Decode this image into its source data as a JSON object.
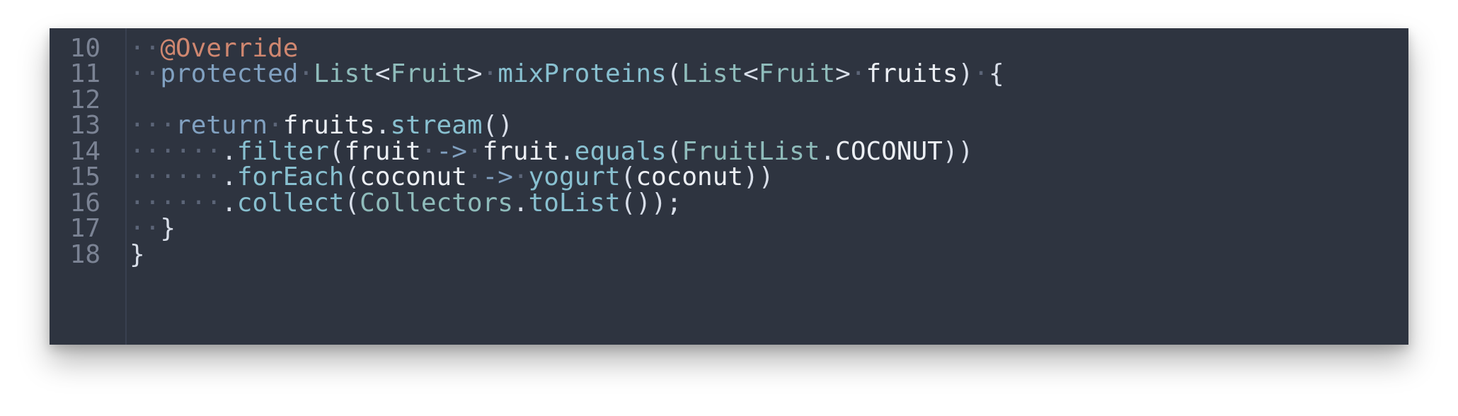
{
  "editor": {
    "lines": [
      {
        "number": "10",
        "tokens": [
          {
            "t": "··",
            "c": "ws"
          },
          {
            "t": "@Override",
            "c": "ann"
          }
        ]
      },
      {
        "number": "11",
        "tokens": [
          {
            "t": "··",
            "c": "ws"
          },
          {
            "t": "protected",
            "c": "kw"
          },
          {
            "t": "·",
            "c": "ws"
          },
          {
            "t": "List",
            "c": "ty"
          },
          {
            "t": "<",
            "c": "pu"
          },
          {
            "t": "Fruit",
            "c": "ty"
          },
          {
            "t": ">",
            "c": "pu"
          },
          {
            "t": "·",
            "c": "ws"
          },
          {
            "t": "mixProteins",
            "c": "fn"
          },
          {
            "t": "(",
            "c": "pu"
          },
          {
            "t": "List",
            "c": "ty"
          },
          {
            "t": "<",
            "c": "pu"
          },
          {
            "t": "Fruit",
            "c": "ty"
          },
          {
            "t": ">",
            "c": "pu"
          },
          {
            "t": "·",
            "c": "ws"
          },
          {
            "t": "fruits",
            "c": "tx"
          },
          {
            "t": ")",
            "c": "pu"
          },
          {
            "t": "·",
            "c": "ws"
          },
          {
            "t": "{",
            "c": "pu"
          }
        ]
      },
      {
        "number": "12",
        "tokens": []
      },
      {
        "number": "13",
        "tokens": [
          {
            "t": "···",
            "c": "ws"
          },
          {
            "t": "return",
            "c": "kw"
          },
          {
            "t": "·",
            "c": "ws"
          },
          {
            "t": "fruits",
            "c": "tx"
          },
          {
            "t": ".",
            "c": "pu"
          },
          {
            "t": "stream",
            "c": "fn"
          },
          {
            "t": "()",
            "c": "pu"
          }
        ]
      },
      {
        "number": "14",
        "tokens": [
          {
            "t": "······",
            "c": "ws"
          },
          {
            "t": ".",
            "c": "pu"
          },
          {
            "t": "filter",
            "c": "fn"
          },
          {
            "t": "(",
            "c": "pu"
          },
          {
            "t": "fruit",
            "c": "tx"
          },
          {
            "t": "·",
            "c": "ws"
          },
          {
            "t": "->",
            "c": "op"
          },
          {
            "t": "·",
            "c": "ws"
          },
          {
            "t": "fruit",
            "c": "tx"
          },
          {
            "t": ".",
            "c": "pu"
          },
          {
            "t": "equals",
            "c": "fn"
          },
          {
            "t": "(",
            "c": "pu"
          },
          {
            "t": "FruitList",
            "c": "ty"
          },
          {
            "t": ".",
            "c": "pu"
          },
          {
            "t": "COCONUT",
            "c": "tx"
          },
          {
            "t": "))",
            "c": "pu"
          }
        ]
      },
      {
        "number": "15",
        "tokens": [
          {
            "t": "······",
            "c": "ws"
          },
          {
            "t": ".",
            "c": "pu"
          },
          {
            "t": "forEach",
            "c": "fn"
          },
          {
            "t": "(",
            "c": "pu"
          },
          {
            "t": "coconut",
            "c": "tx"
          },
          {
            "t": "·",
            "c": "ws"
          },
          {
            "t": "->",
            "c": "op"
          },
          {
            "t": "·",
            "c": "ws"
          },
          {
            "t": "yogurt",
            "c": "fn"
          },
          {
            "t": "(",
            "c": "pu"
          },
          {
            "t": "coconut",
            "c": "tx"
          },
          {
            "t": "))",
            "c": "pu"
          }
        ]
      },
      {
        "number": "16",
        "tokens": [
          {
            "t": "······",
            "c": "ws"
          },
          {
            "t": ".",
            "c": "pu"
          },
          {
            "t": "collect",
            "c": "fn"
          },
          {
            "t": "(",
            "c": "pu"
          },
          {
            "t": "Collectors",
            "c": "ty"
          },
          {
            "t": ".",
            "c": "pu"
          },
          {
            "t": "toList",
            "c": "fn"
          },
          {
            "t": "());",
            "c": "pu"
          }
        ]
      },
      {
        "number": "17",
        "tokens": [
          {
            "t": "··",
            "c": "ws"
          },
          {
            "t": "}",
            "c": "pu"
          }
        ]
      },
      {
        "number": "18",
        "tokens": [
          {
            "t": "}",
            "c": "pu"
          }
        ]
      }
    ],
    "colors": {
      "background": "#2e3440",
      "keyword": "#81a1c1",
      "annotation": "#d08770",
      "type": "#8fbcbb",
      "function": "#88c0d0",
      "text": "#eceff4",
      "line_number": "#7b8394",
      "whitespace_marker": "#5c6578"
    }
  }
}
